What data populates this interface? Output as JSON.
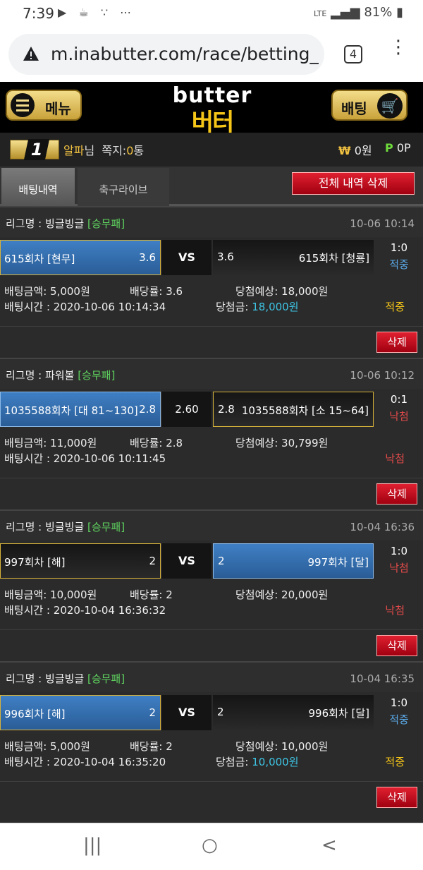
{
  "status": {
    "time": "7:39",
    "left_icons": "▶ ☕ ∵ ⋯",
    "network": "LTE",
    "battery": "81%"
  },
  "browser": {
    "url": "m.inabutter.com/race/betting_lis",
    "tab_count": "4"
  },
  "header": {
    "menu_label": "메뉴",
    "bet_label": "배팅",
    "logo_en": "butter",
    "logo_ko": "버터"
  },
  "user": {
    "rank": "1",
    "name": "알파",
    "suffix": "님",
    "msg_label": "쪽지:",
    "msg_count": "0",
    "msg_unit": "통",
    "money": "0원",
    "points": "0P",
    "money_symbol": "₩",
    "point_symbol": "P"
  },
  "tabs": {
    "history": "배팅내역",
    "live": "축구라이브",
    "delete_all": "전체 내역 삭제"
  },
  "labels": {
    "league": "리그명 : ",
    "amount": "배팅금액: ",
    "odds": "배당률: ",
    "expected": "당첨예상: ",
    "time": "배팅시간 : ",
    "win_amount": "당첨금: ",
    "delete": "삭제"
  },
  "bets": [
    {
      "league": "빙글빙글",
      "type": "[승무패]",
      "date": "10-06 10:14",
      "teamA": "615회차 [현무]",
      "oddA": "3.6",
      "mid": "VS",
      "oddB": "3.6",
      "teamB": "615회차 [청룡]",
      "score": "1:0",
      "result": "적중",
      "amount": "5,000원",
      "odds": "3.6",
      "expected": "18,000원",
      "time": "2020-10-06 10:14:34",
      "win_amount": "18,000원",
      "status": "적중"
    },
    {
      "league": "파워볼",
      "type": "[승무패]",
      "date": "10-06 10:12",
      "teamA": "1035588회차 [대 81~130]",
      "oddA": "2.8",
      "mid": "2.60",
      "oddB": "2.8",
      "teamB": "1035588회차 [소 15~64]",
      "score": "0:1",
      "result": "낙첨",
      "amount": "11,000원",
      "odds": "2.8",
      "expected": "30,799원",
      "time": "2020-10-06 10:11:45",
      "win_amount": "",
      "status": "낙첨"
    },
    {
      "league": "빙글빙글",
      "type": "[승무패]",
      "date": "10-04 16:36",
      "teamA": "997회차 [해]",
      "oddA": "2",
      "mid": "VS",
      "oddB": "2",
      "teamB": "997회차 [달]",
      "score": "1:0",
      "result": "낙첨",
      "amount": "10,000원",
      "odds": "2",
      "expected": "20,000원",
      "time": "2020-10-04 16:36:32",
      "win_amount": "",
      "status": "낙첨"
    },
    {
      "league": "빙글빙글",
      "type": "[승무패]",
      "date": "10-04 16:35",
      "teamA": "996회차 [해]",
      "oddA": "2",
      "mid": "VS",
      "oddB": "2",
      "teamB": "996회차 [달]",
      "score": "1:0",
      "result": "적중",
      "amount": "5,000원",
      "odds": "2",
      "expected": "10,000원",
      "time": "2020-10-04 16:35:20",
      "win_amount": "10,000원",
      "status": "적중"
    }
  ],
  "colors": {
    "selected": "#3f7fc4",
    "win": "#5aa8e6",
    "lose": "#e24a4a",
    "accent_gold": "#f5c518",
    "delete_red": "#c0101e"
  },
  "nav": {
    "recent": "|||",
    "home": "○",
    "back": "<"
  }
}
